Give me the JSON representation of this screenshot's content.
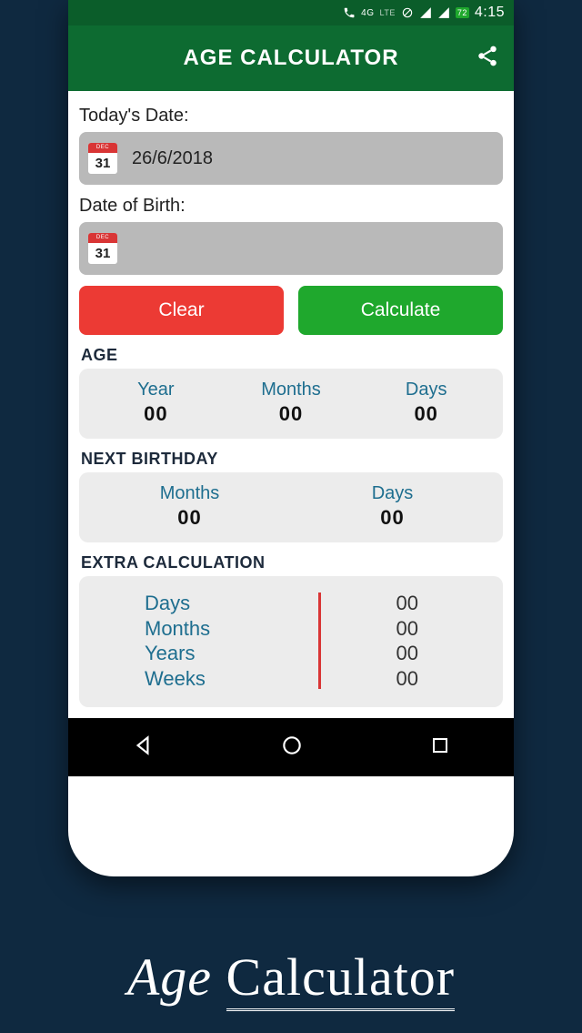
{
  "statusbar": {
    "net": "4G",
    "lte": "LTE",
    "battery": "72",
    "time": "4:15"
  },
  "appbar": {
    "title": "AGE CALCULATOR"
  },
  "fields": {
    "today_label": "Today's Date:",
    "today_value": "26/6/2018",
    "dob_label": "Date of Birth:",
    "dob_value": "",
    "cal_month": "DEC",
    "cal_day": "31"
  },
  "buttons": {
    "clear": "Clear",
    "calculate": "Calculate"
  },
  "age": {
    "title": "AGE",
    "year_label": "Year",
    "year_value": "00",
    "months_label": "Months",
    "months_value": "00",
    "days_label": "Days",
    "days_value": "00"
  },
  "next": {
    "title": "NEXT BIRTHDAY",
    "months_label": "Months",
    "months_value": "00",
    "days_label": "Days",
    "days_value": "00"
  },
  "extra": {
    "title": "EXTRA CALCULATION",
    "rows": {
      "days_label": "Days",
      "days_value": "00",
      "months_label": "Months",
      "months_value": "00",
      "years_label": "Years",
      "years_value": "00",
      "weeks_label": "Weeks",
      "weeks_value": "00"
    }
  },
  "caption": {
    "w1": "Age",
    "w2": "Calculator"
  }
}
